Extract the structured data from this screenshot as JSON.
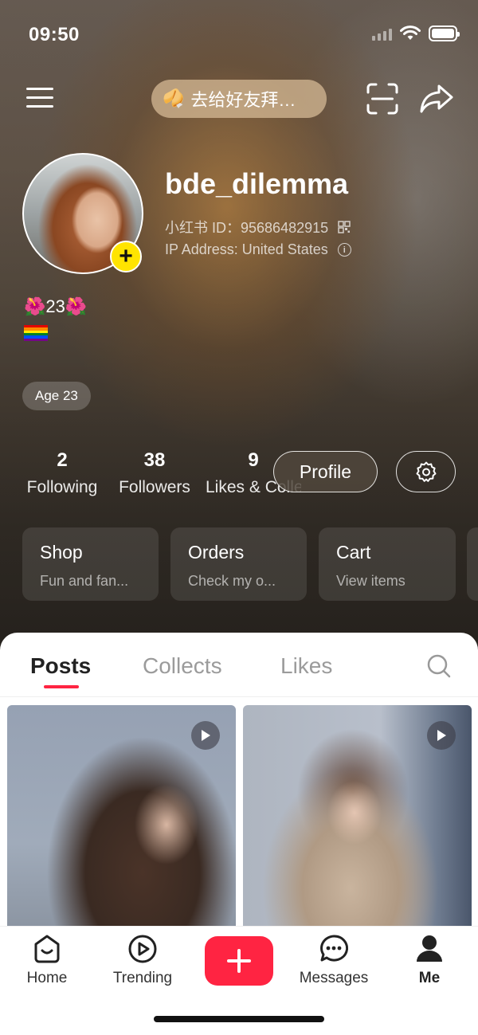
{
  "status_bar": {
    "time": "09:50"
  },
  "header": {
    "promo_text": "去给好友拜…",
    "promo_icon": "🥠",
    "username": "bde_dilemma",
    "red_id_label": "小红书 ID：",
    "red_id": "95686482915",
    "ip_address": "IP Address: United States",
    "bio_line1": "🌺23🌺",
    "age_tag": "Age 23",
    "avatar_add": "+"
  },
  "stats": {
    "following": {
      "value": "2",
      "label": "Following"
    },
    "followers": {
      "value": "38",
      "label": "Followers"
    },
    "likes": {
      "value": "9",
      "label": "Likes & Collects"
    }
  },
  "buttons": {
    "profile": "Profile"
  },
  "cards": [
    {
      "title": "Shop",
      "subtitle": "Fun and fan..."
    },
    {
      "title": "Orders",
      "subtitle": "Check my o..."
    },
    {
      "title": "Cart",
      "subtitle": "View items"
    }
  ],
  "tabs": {
    "posts": "Posts",
    "collects": "Collects",
    "likes": "Likes"
  },
  "bottom_nav": {
    "home": "Home",
    "trending": "Trending",
    "messages": "Messages",
    "me": "Me"
  },
  "colors": {
    "accent": "#ff2442",
    "avatar_badge": "#ffe400"
  },
  "icons": {
    "menu": "hamburger-menu-icon",
    "scan": "scan-icon",
    "share": "share-arrow-icon",
    "settings": "gear-icon",
    "search": "search-icon",
    "play": "play-icon",
    "qr": "qr-code-icon",
    "info": "info-icon"
  }
}
